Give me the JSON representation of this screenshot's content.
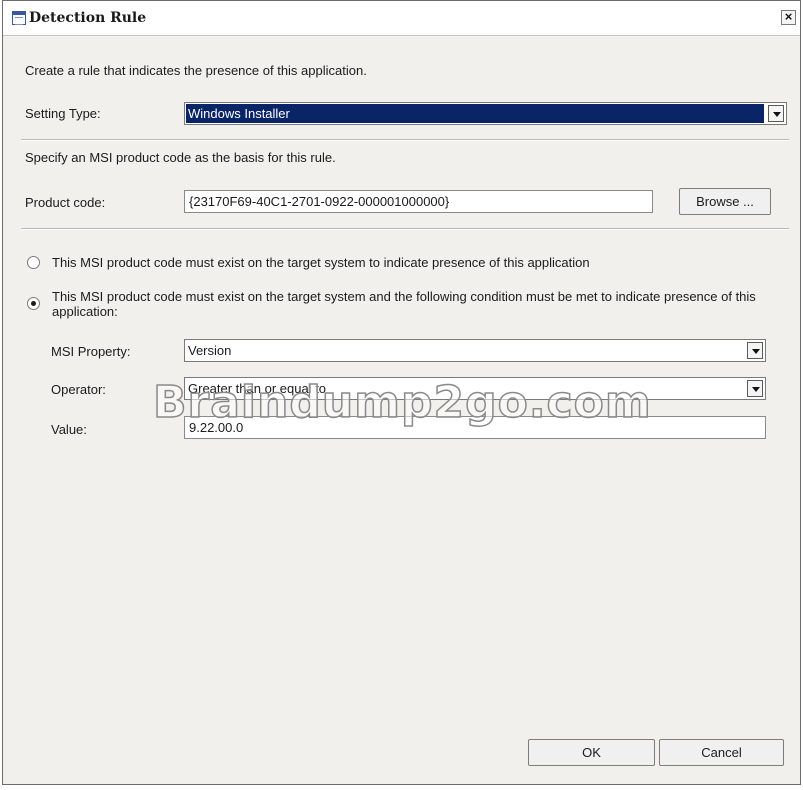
{
  "window": {
    "title": "Detection Rule",
    "close_glyph": "×"
  },
  "intro_text": "Create a rule that indicates the presence of this application.",
  "setting_type": {
    "label": "Setting Type:",
    "value": "Windows Installer"
  },
  "msi_instruction": "Specify an MSI product code as the basis for this rule.",
  "product_code": {
    "label": "Product code:",
    "value": "{23170F69-40C1-2701-0922-000001000000}",
    "browse_label": "Browse ..."
  },
  "options": {
    "exist_only": {
      "label": "This MSI product code must exist on the target system to indicate presence of this application",
      "checked": false
    },
    "exist_condition": {
      "label": "This MSI product code must exist on the target system and the following condition must be met to indicate presence of this application:",
      "checked": true
    }
  },
  "condition": {
    "msi_property_label": "MSI Property:",
    "msi_property_value": "Version",
    "operator_label": "Operator:",
    "operator_value": "Greater than or equal to",
    "value_label": "Value:",
    "value": "9.22.00.0"
  },
  "watermark": "Braindump2go.com",
  "buttons": {
    "ok": "OK",
    "cancel": "Cancel"
  },
  "colors": {
    "selection_bg": "#0a2468",
    "dialog_bg": "#f1f0ec"
  }
}
